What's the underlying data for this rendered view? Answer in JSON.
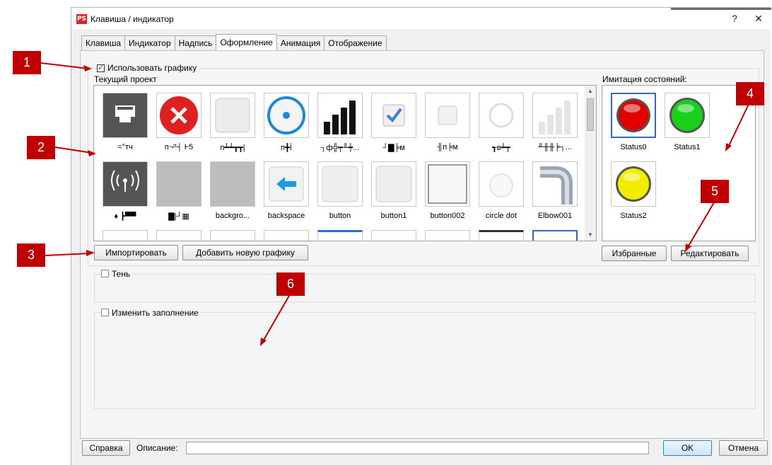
{
  "window": {
    "title": "Клавиша / индикатор",
    "app_icon": "PS",
    "help_label": "?",
    "close_label": "✕"
  },
  "tabs": [
    "Клавиша",
    "Индикатор",
    "Надпись",
    "Оформление",
    "Анимация",
    "Отображение"
  ],
  "active_tab": "Оформление",
  "use_graphics": {
    "label": "Использовать графику",
    "checked": true
  },
  "current_project_label": "Текущий проект",
  "gallery_captions_row1": [
    "=°тч",
    "п¬ᵗᵗ┤ Ⱶ5",
    "п┷┷┳┳|",
    "п╋Ϊ",
    "┐ф╬┯╨┿...",
    "┘▇╞м",
    "╢п╞м",
    "┱в┷┯",
    "╨╫╫╞┐..."
  ],
  "gallery_captions_row2": [
    "♦ ┣▀▀",
    "▇|┘▦",
    "backgro...",
    "backspace",
    "button",
    "button1",
    "button002",
    "circle dot",
    "Elbow001"
  ],
  "state_simulation_label": "Имитация состояний:",
  "states": [
    {
      "name": "Status0",
      "color": "#e00000"
    },
    {
      "name": "Status1",
      "color": "#19d019"
    },
    {
      "name": "Status2",
      "color": "#f1ee00"
    }
  ],
  "buttons": {
    "import": "Импортировать",
    "add_graphic": "Добавить новую графику",
    "favorites": "Избранные",
    "edit": "Редактировать",
    "help": "Справка",
    "ok": "OK",
    "cancel": "Отмена"
  },
  "shadow": {
    "label": "Тень",
    "checked": false
  },
  "change_fill": {
    "label": "Изменить заполнение",
    "checked": false
  },
  "description_label": "Описание:",
  "description_value": "",
  "callouts": [
    "1",
    "2",
    "3",
    "4",
    "5",
    "6"
  ],
  "colors": {
    "callout": "#c00000",
    "selection": "#3366cc"
  }
}
